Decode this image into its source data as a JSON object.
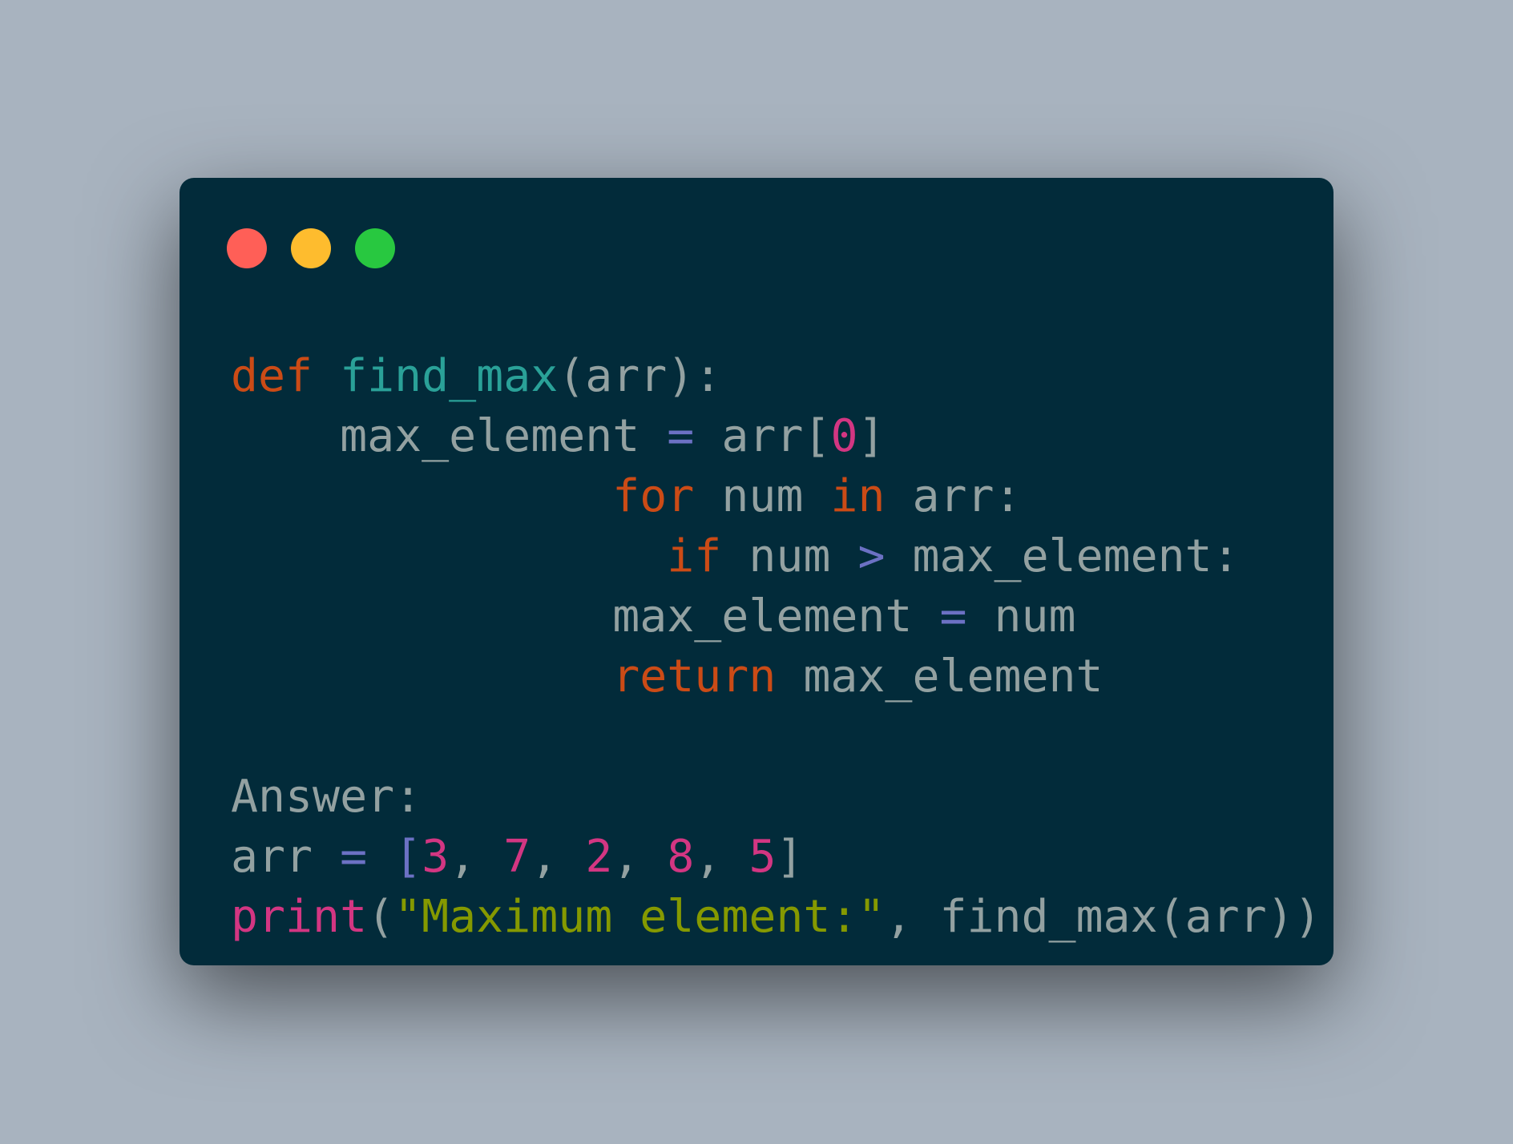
{
  "window": {
    "controls": {
      "close_color": "#ff5f57",
      "minimize_color": "#febc2e",
      "maximize_color": "#28c840"
    }
  },
  "code": {
    "language": "python",
    "line1": {
      "kw_def": "def",
      "fn_name": "find_max",
      "rest": "(arr):"
    },
    "line2": {
      "indent": "    ",
      "var": "max_element",
      "op": "=",
      "arr": "arr[",
      "num": "0",
      "close": "]"
    },
    "line3": {
      "indent": "              ",
      "kw_for": "for",
      "mid": "num",
      "kw_in": "in",
      "rest": "arr:"
    },
    "line4": {
      "indent": "                ",
      "kw_if": "if",
      "mid": "num",
      "op": ">",
      "rest": "max_element:"
    },
    "line5": {
      "indent": "              ",
      "var": "max_element",
      "op": "=",
      "rest": "num"
    },
    "line6": {
      "indent": "              ",
      "kw_return": "return",
      "rest": "max_element"
    },
    "line8": {
      "text": "Answer:"
    },
    "line9": {
      "var": "arr",
      "op": "=",
      "open": "[",
      "nums": [
        "3",
        "7",
        "2",
        "8",
        "5"
      ],
      "sep": ", ",
      "close": "]"
    },
    "line10": {
      "fn_print": "print",
      "open": "(",
      "string": "\"Maximum element:\"",
      "rest": ", find_max(arr))"
    }
  }
}
